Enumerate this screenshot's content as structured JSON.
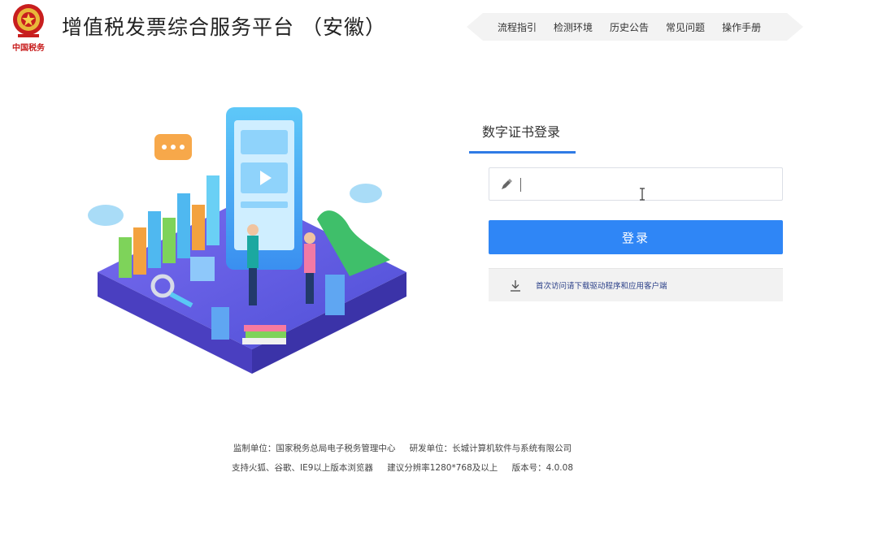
{
  "header": {
    "title": "增值税发票综合服务平台 （安徽）",
    "logo_text": "中国税务"
  },
  "nav": {
    "items": [
      "流程指引",
      "检测环境",
      "历史公告",
      "常见问题",
      "操作手册"
    ]
  },
  "login": {
    "tab_label": "数字证书登录",
    "pin_value": "",
    "button_label": "登录",
    "download_text": "首次访问请下载驱动程序和应用客户端"
  },
  "footer": {
    "line1_left": "监制单位：国家税务总局电子税务管理中心",
    "line1_right": "研发单位：长城计算机软件与系统有限公司",
    "line2_browsers": "支持火狐、谷歌、IE9以上版本浏览器",
    "line2_resolution": "建议分辨率1280*768及以上",
    "line2_version": "版本号：4.0.08"
  },
  "colors": {
    "accent": "#2f86f6",
    "tab_underline": "#2f7be5",
    "download_text": "#2a3f88",
    "platform": "#5b5be0"
  }
}
